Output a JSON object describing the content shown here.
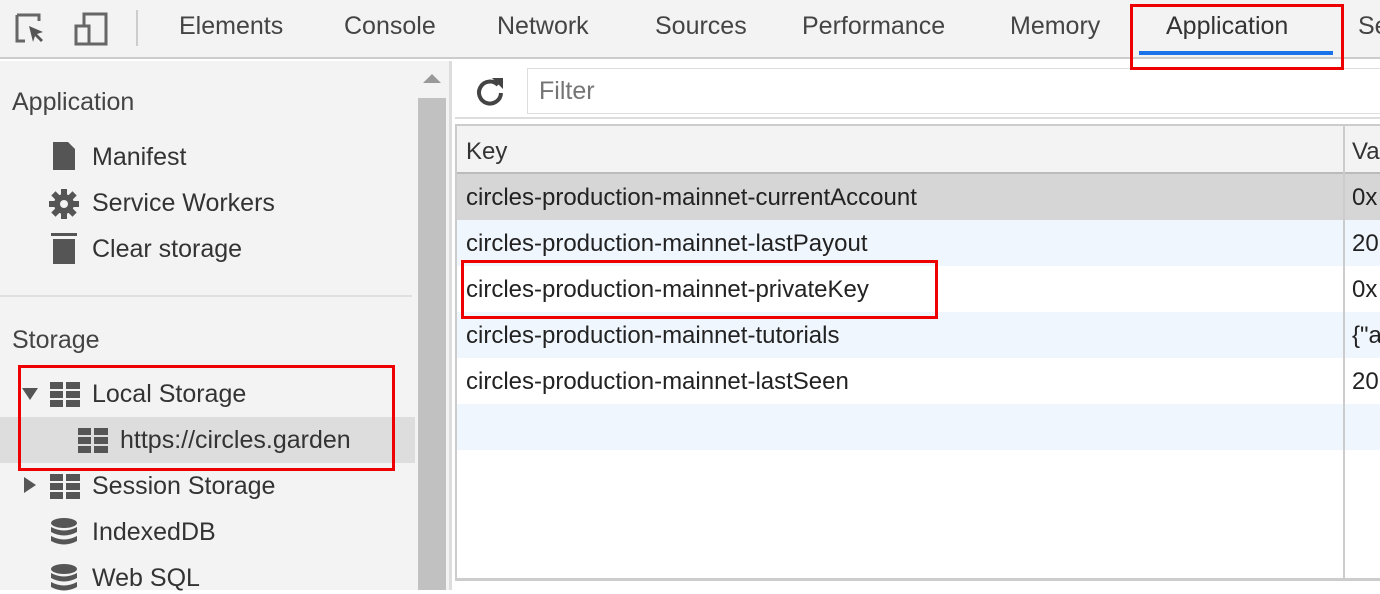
{
  "toolbar": {
    "tabs": [
      "Elements",
      "Console",
      "Network",
      "Sources",
      "Performance",
      "Memory",
      "Application",
      "Se"
    ],
    "active_tab": "Application"
  },
  "sidebar": {
    "application_heading": "Application",
    "application_items": [
      {
        "label": "Manifest",
        "icon": "file-icon"
      },
      {
        "label": "Service Workers",
        "icon": "gear-icon"
      },
      {
        "label": "Clear storage",
        "icon": "trash-icon"
      }
    ],
    "storage_heading": "Storage",
    "storage_items": [
      {
        "label": "Local Storage",
        "icon": "grid-icon",
        "expanded": true
      },
      {
        "label": "https://circles.garden",
        "icon": "grid-icon",
        "selected": true
      },
      {
        "label": "Session Storage",
        "icon": "grid-icon",
        "expanded": false
      },
      {
        "label": "IndexedDB",
        "icon": "database-icon"
      },
      {
        "label": "Web SQL",
        "icon": "database-icon"
      }
    ]
  },
  "main": {
    "filter_placeholder": "Filter",
    "columns": [
      "Key",
      "Va"
    ],
    "rows": [
      {
        "key": "circles-production-mainnet-currentAccount",
        "value": "0x"
      },
      {
        "key": "circles-production-mainnet-lastPayout",
        "value": "20"
      },
      {
        "key": "circles-production-mainnet-privateKey",
        "value": "0x"
      },
      {
        "key": "circles-production-mainnet-tutorials",
        "value": "{\"a"
      },
      {
        "key": "circles-production-mainnet-lastSeen",
        "value": "20"
      }
    ]
  },
  "colors": {
    "highlight": "#ff0000",
    "active_tab_underline": "#1a73e8",
    "selected_row": "#d6d6d6",
    "alt_row": "#f0f6fd"
  }
}
